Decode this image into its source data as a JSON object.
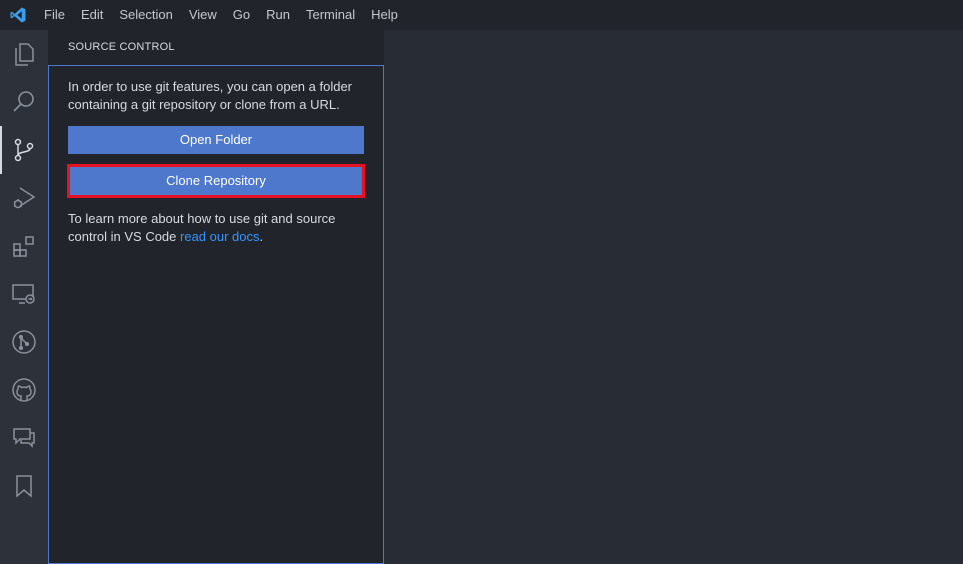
{
  "menu": {
    "items": [
      "File",
      "Edit",
      "Selection",
      "View",
      "Go",
      "Run",
      "Terminal",
      "Help"
    ]
  },
  "activity_bar": {
    "items": [
      {
        "icon": "explorer-icon"
      },
      {
        "icon": "search-icon"
      },
      {
        "icon": "source-control-icon",
        "active": true
      },
      {
        "icon": "run-debug-icon"
      },
      {
        "icon": "extensions-icon"
      },
      {
        "icon": "remote-explorer-icon"
      },
      {
        "icon": "git-graph-icon"
      },
      {
        "icon": "github-icon"
      },
      {
        "icon": "comments-icon"
      },
      {
        "icon": "bookmarks-icon"
      }
    ]
  },
  "sidebar": {
    "title": "SOURCE CONTROL",
    "intro_text": "In order to use git features, you can open a folder containing a git repository or clone from a URL.",
    "open_folder_label": "Open Folder",
    "clone_repo_label": "Clone Repository",
    "learn_prefix": "To learn more about how to use git and source control in VS Code ",
    "docs_link": "read our docs",
    "learn_suffix": "."
  },
  "colors": {
    "accent": "#4d78cc",
    "highlight": "#e81123",
    "link": "#3794ff"
  }
}
